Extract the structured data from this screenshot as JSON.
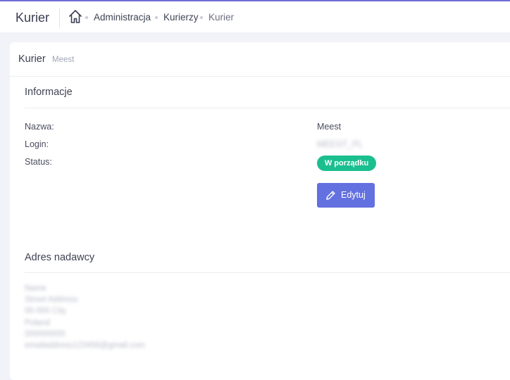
{
  "header": {
    "app_title": "Kurier",
    "breadcrumbs": [
      "Administracja",
      "Kurierzy",
      "Kurier"
    ]
  },
  "card": {
    "title": "Kurier",
    "subtitle": "Meest"
  },
  "info": {
    "section_title": "Informacje",
    "fields": [
      {
        "label": "Nazwa:",
        "value": "Meest"
      },
      {
        "label": "Login:",
        "value": "MEEST_PL"
      },
      {
        "label": "Status:",
        "value": "W porządku"
      }
    ],
    "edit_label": "Edytuj"
  },
  "address": {
    "section_title": "Adres nadawcy",
    "lines": [
      "Name",
      "Street Address",
      "00-000 City",
      "Poland",
      "000000000",
      "emailaddress123456@gmail.com"
    ]
  },
  "colors": {
    "accent": "#6370e0",
    "status_ok": "#1bbf8f",
    "topbar_line": "#6f6cd8"
  }
}
